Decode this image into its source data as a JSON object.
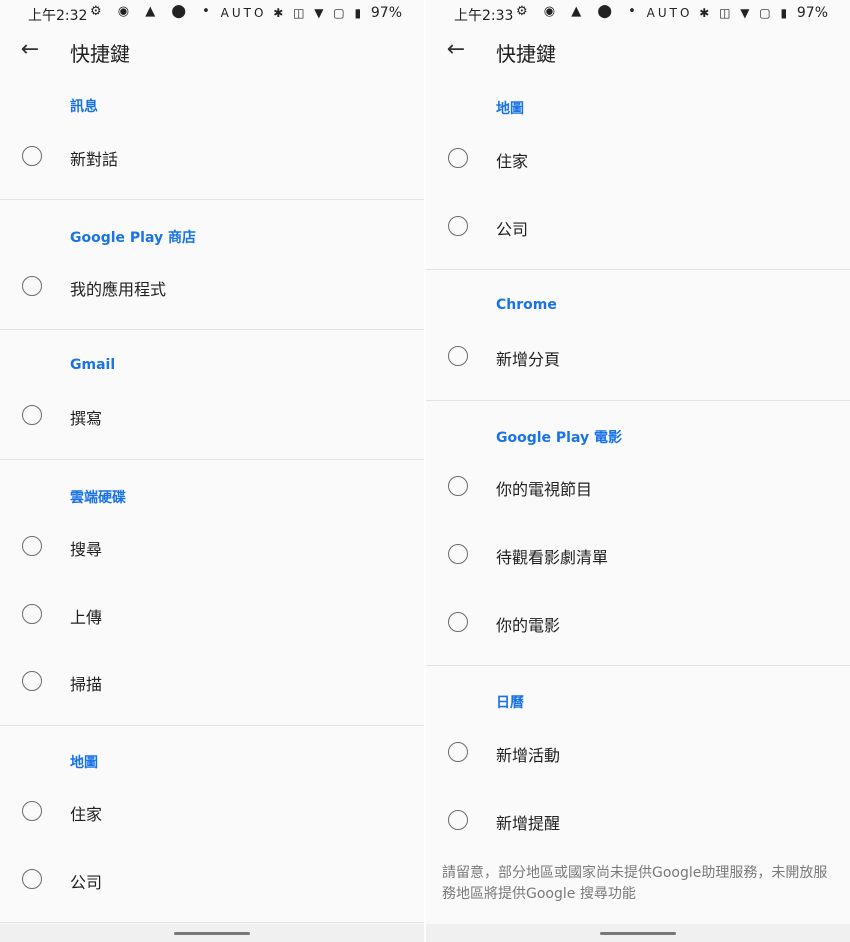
{
  "left": {
    "status": {
      "time": "上午2:32",
      "left_icons": "⚙ ◉ ▲ ⬤ •",
      "right_icons": "AUTO ✱ ◫ ▼ ▢ ▮",
      "battery": "97%"
    },
    "title": "快捷鍵",
    "sections": [
      {
        "header": "訊息",
        "items": [
          "新對話"
        ]
      },
      {
        "header": "Google Play 商店",
        "items": [
          "我的應用程式"
        ]
      },
      {
        "header": "Gmail",
        "items": [
          "撰寫"
        ]
      },
      {
        "header": "雲端硬碟",
        "items": [
          "搜尋",
          "上傳",
          "掃描"
        ]
      },
      {
        "header": "地圖",
        "items": [
          "住家",
          "公司"
        ]
      }
    ]
  },
  "right": {
    "status": {
      "time": "上午2:33",
      "left_icons": "⚙ ◉ ▲ ⬤ •",
      "right_icons": "AUTO ✱ ◫ ▼ ▢ ▮",
      "battery": "97%"
    },
    "title": "快捷鍵",
    "sections": [
      {
        "header": "地圖",
        "items": [
          "住家",
          "公司"
        ]
      },
      {
        "header": "Chrome",
        "items": [
          "新增分頁"
        ]
      },
      {
        "header": "Google Play 電影",
        "items": [
          "你的電視節目",
          "待觀看影劇清單",
          "你的電影"
        ]
      },
      {
        "header": "日曆",
        "items": [
          "新增活動",
          "新增提醒"
        ]
      }
    ],
    "note": "請留意，部分地區或國家尚未提供Google助理服務，未開放服務地區將提供Google 搜尋功能"
  }
}
